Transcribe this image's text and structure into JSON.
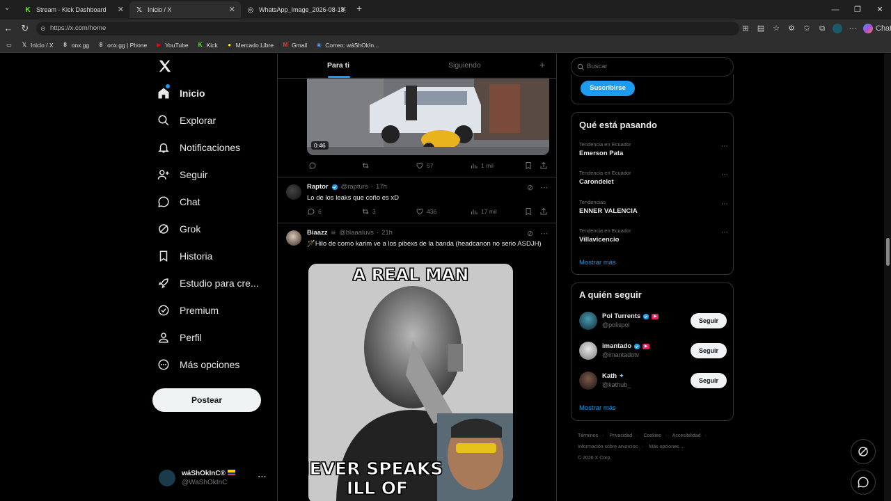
{
  "browser": {
    "tabs": [
      {
        "title": "Stream - Kick Dashboard",
        "icon": "kick-icon"
      },
      {
        "title": "Inicio / X",
        "icon": "x-icon"
      },
      {
        "title": "WhatsApp_Image_2026-08-18_at...",
        "icon": "globe-icon"
      }
    ],
    "url": "https://x.com/home",
    "chat_label": "Chat",
    "bookmarks": [
      "Inicio / X",
      "onx.gg",
      "onx.gg | Phone",
      "YouTube",
      "Kick",
      "Mercado Libre",
      "Gmail",
      "Correo: wáShOkIn..."
    ]
  },
  "nav": {
    "items": [
      "Inicio",
      "Explorar",
      "Notificaciones",
      "Seguir",
      "Chat",
      "Grok",
      "Historia",
      "Estudio para cre...",
      "Premium",
      "Perfil",
      "Más opciones"
    ],
    "post_label": "Postear",
    "account_name": "wáShOkInC®",
    "account_handle": "@WaShOkInC"
  },
  "feed": {
    "tabs": [
      "Para ti",
      "Siguiendo"
    ],
    "video_duration": "0:46",
    "first_actions": {
      "likes": "57",
      "views": "1 mil"
    },
    "tweets": [
      {
        "name": "Raptor",
        "handle": "@rapturs",
        "time": "17h",
        "text": "Lo de los leaks que coño es xD",
        "replies": "6",
        "retweets": "3",
        "likes": "436",
        "views": "17 mil"
      },
      {
        "name": "Biaazz",
        "handle": "@blaaaluvs",
        "time": "21h",
        "text": "🪄Hilo de como karim ve a los pibexs de la banda (headcanon no serio ASDJH)",
        "meme_top": "A REAL MAN",
        "meme_bottom1": "NEVER SPEAKS",
        "meme_bottom2": "ILL OF"
      }
    ]
  },
  "sidebar": {
    "search_placeholder": "Buscar",
    "subscribe_label": "Suscribirse",
    "trends_title": "Qué está pasando",
    "trends": [
      {
        "context": "Tendencia en Ecuador",
        "topic": "Emerson Pata"
      },
      {
        "context": "Tendencia en Ecuador",
        "topic": "Carondelet"
      },
      {
        "context": "Tendencias",
        "topic": "ENNER VALENCIA"
      },
      {
        "context": "Tendencia en Ecuador",
        "topic": "Villavicencio"
      }
    ],
    "show_more": "Mostrar más",
    "who_title": "A quién seguir",
    "who": [
      {
        "name": "Pol Turrents",
        "handle": "@polispol",
        "btn": "Seguir"
      },
      {
        "name": "imantado",
        "handle": "@imantadotv",
        "btn": "Seguir"
      },
      {
        "name": "Kath",
        "handle": "@kathub_",
        "btn": "Seguir"
      }
    ],
    "footer": [
      "Términos",
      "Privacidad",
      "Cookies",
      "Accesibilidad",
      "Información sobre anuncios",
      "Más opciones ...",
      "© 2026 X Corp."
    ]
  },
  "colors": {
    "accent": "#1d9bf0",
    "background": "#000000",
    "text": "#e7e9ea",
    "muted": "#71767b"
  }
}
